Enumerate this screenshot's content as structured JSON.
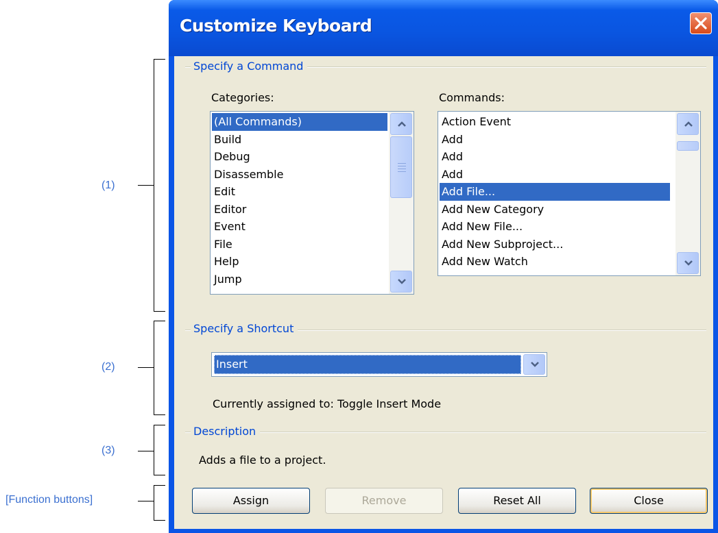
{
  "annotations": [
    {
      "label": "(1)"
    },
    {
      "label": "(2)"
    },
    {
      "label": "(3)"
    },
    {
      "label": "[Function buttons]"
    }
  ],
  "dialog": {
    "title": "Customize Keyboard",
    "close_icon": "close-icon"
  },
  "command_group": {
    "title": "Specify a Command",
    "categories_label": "Categories:",
    "commands_label": "Commands:",
    "categories": [
      {
        "label": "(All Commands)",
        "selected": true
      },
      {
        "label": "Build"
      },
      {
        "label": "Debug"
      },
      {
        "label": "Disassemble"
      },
      {
        "label": "Edit"
      },
      {
        "label": "Editor"
      },
      {
        "label": "Event"
      },
      {
        "label": "File"
      },
      {
        "label": "Help"
      },
      {
        "label": "Jump"
      }
    ],
    "commands": [
      {
        "label": "Action Event"
      },
      {
        "label": "Add"
      },
      {
        "label": "Add"
      },
      {
        "label": "Add"
      },
      {
        "label": "Add File...",
        "selected": true
      },
      {
        "label": "Add New Category"
      },
      {
        "label": "Add New File..."
      },
      {
        "label": "Add New Subproject..."
      },
      {
        "label": "Add New Watch"
      }
    ]
  },
  "shortcut_group": {
    "title": "Specify a Shortcut",
    "shortcut_value": "Insert",
    "assigned_text": "Currently assigned to: Toggle Insert Mode"
  },
  "description_group": {
    "title": "Description",
    "text": "Adds a file to a project."
  },
  "buttons": {
    "assign": "Assign",
    "remove": "Remove",
    "reset_all": "Reset All",
    "close": "Close"
  },
  "colors": {
    "accent": "#0046d5",
    "selection": "#316ac5",
    "titlebar": "#0a55e6",
    "annotation": "#3a6fd0"
  }
}
